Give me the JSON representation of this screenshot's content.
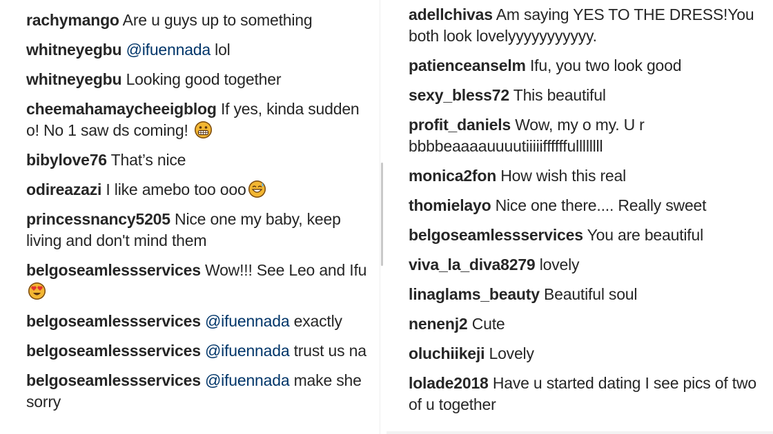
{
  "left_comments": [
    {
      "user": "rachymango",
      "parts": [
        {
          "t": "text",
          "v": " Are u guys up to something"
        }
      ]
    },
    {
      "user": "whitneyegbu",
      "parts": [
        {
          "t": "text",
          "v": " "
        },
        {
          "t": "mention",
          "v": "@ifuennada"
        },
        {
          "t": "text",
          "v": " lol"
        }
      ]
    },
    {
      "user": "whitneyegbu",
      "parts": [
        {
          "t": "text",
          "v": " Looking good together"
        }
      ]
    },
    {
      "user": "cheemahamaycheeigblog",
      "parts": [
        {
          "t": "text",
          "v": " If yes, kinda sudden o! No 1 saw ds coming! "
        },
        {
          "t": "emoji",
          "v": "grimacing-emoji"
        }
      ]
    },
    {
      "user": "bibylove76",
      "parts": [
        {
          "t": "text",
          "v": " That’s nice"
        }
      ]
    },
    {
      "user": "odireazazi",
      "parts": [
        {
          "t": "text",
          "v": " I like amebo too ooo"
        },
        {
          "t": "emoji",
          "v": "sweat-smile-emoji"
        }
      ]
    },
    {
      "user": "princessnancy5205",
      "parts": [
        {
          "t": "text",
          "v": " Nice one my baby, keep living and don't mind them"
        }
      ]
    },
    {
      "user": "belgoseamlessservices",
      "parts": [
        {
          "t": "text",
          "v": " Wow!!! See Leo and Ifu "
        },
        {
          "t": "emoji",
          "v": "heart-eyes-emoji"
        }
      ]
    },
    {
      "user": "belgoseamlessservices",
      "parts": [
        {
          "t": "text",
          "v": " "
        },
        {
          "t": "mention",
          "v": "@ifuennada"
        },
        {
          "t": "text",
          "v": " exactly"
        }
      ]
    },
    {
      "user": "belgoseamlessservices",
      "parts": [
        {
          "t": "text",
          "v": " "
        },
        {
          "t": "mention",
          "v": "@ifuennada"
        },
        {
          "t": "text",
          "v": " trust us na"
        }
      ]
    },
    {
      "user": "belgoseamlessservices",
      "parts": [
        {
          "t": "text",
          "v": " "
        },
        {
          "t": "mention",
          "v": "@ifuennada"
        },
        {
          "t": "text",
          "v": " make she sorry"
        }
      ]
    }
  ],
  "right_comments": [
    {
      "user": "adellchivas",
      "parts": [
        {
          "t": "text",
          "v": " Am saying YES TO THE DRESS!You both look lovelyyyyyyyyyyy."
        }
      ]
    },
    {
      "user": "patienceanselm",
      "parts": [
        {
          "t": "text",
          "v": " Ifu, you two look good"
        }
      ]
    },
    {
      "user": "sexy_bless72",
      "parts": [
        {
          "t": "text",
          "v": " This beautiful"
        }
      ]
    },
    {
      "user": "profit_daniels",
      "parts": [
        {
          "t": "text",
          "v": " Wow, my o my. U r bbbbeaaaauuuutiiiiiffffffullllllll"
        }
      ]
    },
    {
      "user": "monica2fon",
      "parts": [
        {
          "t": "text",
          "v": " How wish this real"
        }
      ]
    },
    {
      "user": "thomielayo",
      "parts": [
        {
          "t": "text",
          "v": " Nice one there.... Really sweet"
        }
      ]
    },
    {
      "user": "belgoseamlessservices",
      "parts": [
        {
          "t": "text",
          "v": " You are beautiful"
        }
      ]
    },
    {
      "user": "viva_la_diva8279",
      "parts": [
        {
          "t": "text",
          "v": " lovely"
        }
      ]
    },
    {
      "user": "linaglams_beauty",
      "parts": [
        {
          "t": "text",
          "v": " Beautiful soul"
        }
      ]
    },
    {
      "user": "nenenj2",
      "parts": [
        {
          "t": "text",
          "v": " Cute"
        }
      ]
    },
    {
      "user": "oluchiikeji",
      "parts": [
        {
          "t": "text",
          "v": " Lovely"
        }
      ]
    },
    {
      "user": "lolade2018",
      "parts": [
        {
          "t": "text",
          "v": " Have u started dating I see pics of two of u together"
        }
      ]
    }
  ],
  "colors": {
    "username": "#262626",
    "mention": "#003569",
    "text": "#262626",
    "scrollbar": "#c8c8c8"
  }
}
